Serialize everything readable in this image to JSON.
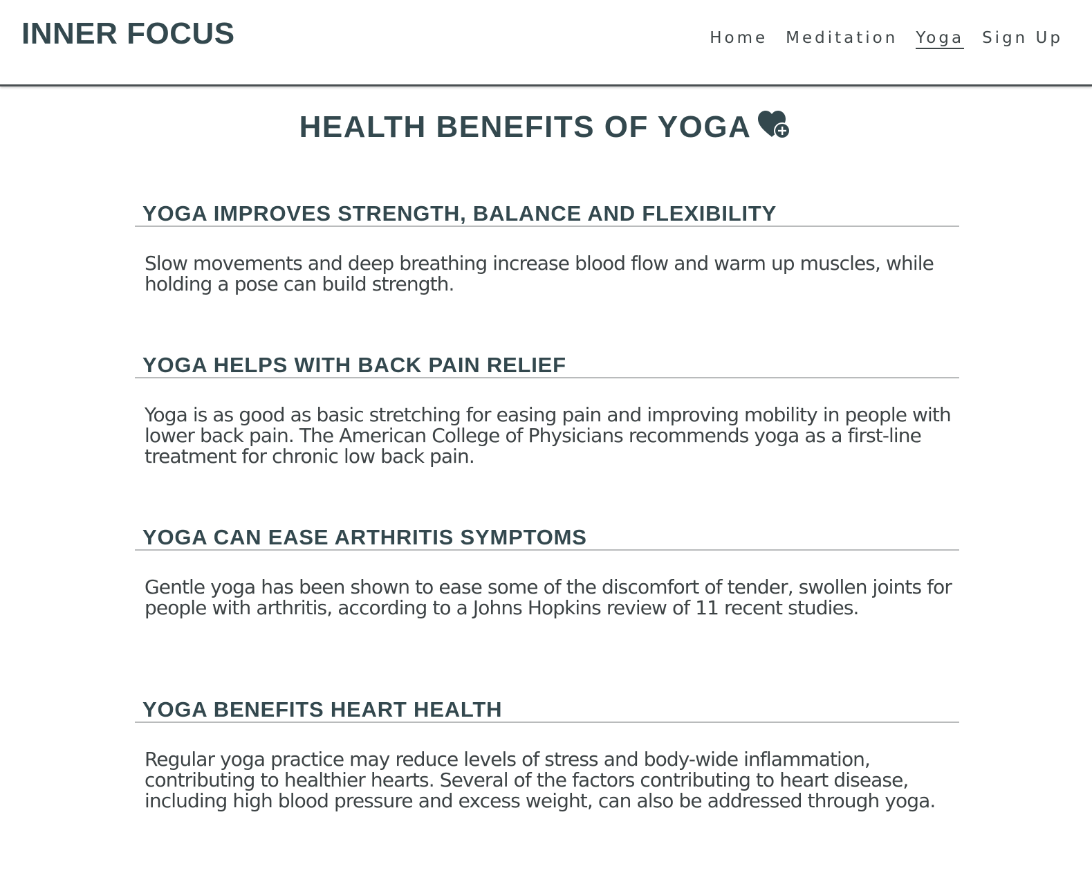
{
  "brand": {
    "name": "INNER FOCUS"
  },
  "nav": {
    "items": [
      {
        "label": "Home",
        "active": false
      },
      {
        "label": "Meditation",
        "active": false
      },
      {
        "label": "Yoga",
        "active": true
      },
      {
        "label": "Sign Up",
        "active": false
      }
    ]
  },
  "page": {
    "title": "HEALTH BENEFITS OF YOGA",
    "title_icon": "heart-plus-icon"
  },
  "sections": [
    {
      "heading": "YOGA IMPROVES STRENGTH, BALANCE AND FLEXIBILITY",
      "body": "Slow movements and deep breathing increase blood flow and warm up muscles, while holding a pose can build strength."
    },
    {
      "heading": "YOGA HELPS WITH BACK PAIN RELIEF",
      "body": "Yoga is as good as basic stretching for easing pain and improving mobility in people with lower back pain. The American College of Physicians recommends yoga as a first-line treatment for chronic low back pain."
    },
    {
      "heading": "YOGA CAN EASE ARTHRITIS SYMPTOMS",
      "body": "Gentle yoga has been shown to ease some of the discomfort of tender, swollen joints for people with arthritis, according to a Johns Hopkins review of 11 recent studies."
    },
    {
      "heading": "YOGA BENEFITS HEART HEALTH",
      "body": "Regular yoga practice may reduce levels of stress and body-wide inflammation, contributing to healthier hearts. Several of the factors contributing to heart disease, including high blood pressure and excess weight, can also be addressed through yoga."
    }
  ],
  "colors": {
    "primary_text": "#33484e",
    "body_text": "#3d4345",
    "divider": "#b9bbbc"
  }
}
